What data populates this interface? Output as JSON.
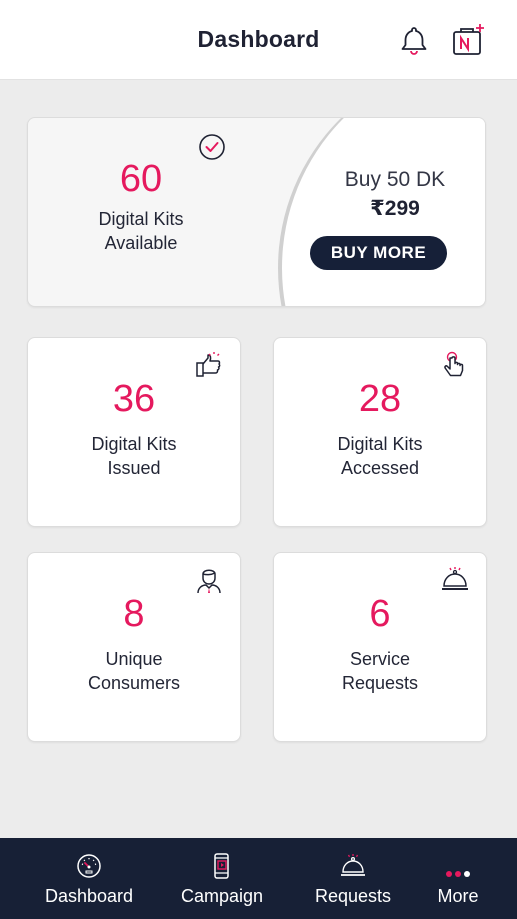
{
  "header": {
    "title": "Dashboard",
    "icons": [
      "bell-icon",
      "digital-kit-add-icon"
    ]
  },
  "available_card": {
    "count": "60",
    "label_line1": "Digital Kits",
    "label_line2": "Available",
    "icon": "check-circle-icon",
    "offer_title": "Buy 50 DK",
    "offer_price": "₹299",
    "buy_button": "BUY MORE"
  },
  "stats": [
    {
      "count": "36",
      "label_line1": "Digital Kits",
      "label_line2": "Issued",
      "icon": "thumbs-up-icon"
    },
    {
      "count": "28",
      "label_line1": "Digital Kits",
      "label_line2": "Accessed",
      "icon": "tap-hand-icon"
    },
    {
      "count": "8",
      "label_line1": "Unique",
      "label_line2": "Consumers",
      "icon": "person-icon"
    },
    {
      "count": "6",
      "label_line1": "Service",
      "label_line2": "Requests",
      "icon": "service-bell-icon"
    }
  ],
  "bottom_nav": [
    {
      "label": "Dashboard",
      "icon": "speedometer-icon"
    },
    {
      "label": "Campaign",
      "icon": "phone-campaign-icon"
    },
    {
      "label": "Requests",
      "icon": "service-bell-icon"
    },
    {
      "label": "More",
      "icon": "more-dots-icon"
    }
  ],
  "colors": {
    "accent": "#e5195e",
    "navy": "#172036",
    "background": "#ececec"
  }
}
